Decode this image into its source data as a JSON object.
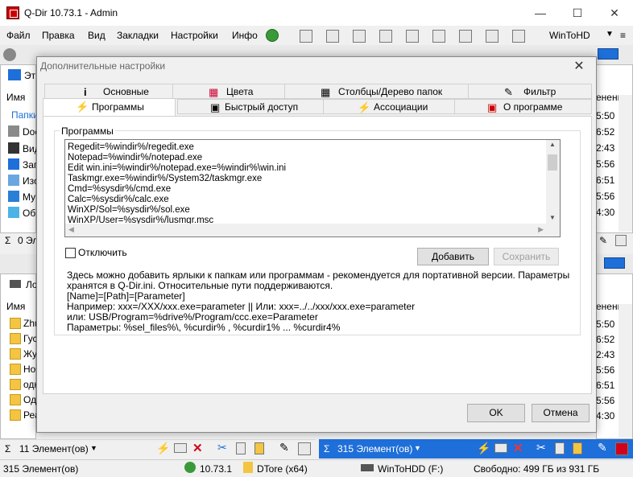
{
  "window": {
    "title": "Q-Dir 10.73.1 - Admin",
    "minimize": "—",
    "maximize": "☐",
    "close": "✕"
  },
  "menu": [
    "Файл",
    "Правка",
    "Вид",
    "Закладки",
    "Настройки",
    "Инфо"
  ],
  "toolbar": {
    "wintohdd_label": "WinToHD"
  },
  "left_pane_top": {
    "address": "Эт",
    "column_name": "Имя",
    "items": [
      "Папки",
      "Doc",
      "Вид",
      "Заг",
      "Изо",
      "Му",
      "Об"
    ],
    "footer_count": "0 Эл"
  },
  "right_pane_top": {
    "column": "енения",
    "times": [
      "5:50",
      "6:52",
      "2:43",
      "5:56",
      "6:51",
      "5:56",
      "4:30"
    ]
  },
  "left_pane_bottom": {
    "address": "Ло",
    "column_name": "Имя",
    "items": [
      "Zhu",
      "Гус",
      "Жу",
      "Но",
      "одн",
      "Оди",
      "Реа"
    ],
    "footer_count": "11 Элемент(ов)"
  },
  "right_pane_bottom": {
    "column": "енения",
    "times": [
      "5:50",
      "6:52",
      "2:43",
      "5:56",
      "6:51",
      "5:56",
      "4:30"
    ],
    "footer_count": "315 Элемент(ов)"
  },
  "dialog": {
    "title": "Дополнительные настройки",
    "close": "✕",
    "tabs_back": [
      "Основные",
      "Цвета",
      "Столбцы/Дерево папок",
      "Фильтр"
    ],
    "tabs_front": [
      "Программы",
      "Быстрый доступ",
      "Ассоциации",
      "О программе"
    ],
    "group_label": "Программы",
    "program_lines": [
      "Regedit=%windir%/regedit.exe",
      "Notepad=%windir%/notepad.exe",
      "Edit win.ini=%windir%/notepad.exe=%windir%\\win.ini",
      "Taskmgr.exe=%windir%/System32/taskmgr.exe",
      "Cmd=%sysdir%/cmd.exe",
      "Calc=%sysdir%/calc.exe",
      "WinXP/Sol=%sysdir%/sol.exe",
      "WinXP/User=%sysdir%/lusmgr.msc"
    ],
    "disable_label": "Отключить",
    "add_button": "Добавить",
    "save_button": "Сохранить",
    "help_lines": [
      "Здесь можно добавить ярлыки к папкам или программам - рекомендуется для портативной версии. Параметры",
      "хранятся в Q-Dir.ini. Относительные пути поддерживаются.",
      "[Name]=[Path]=[Parameter]",
      "Например: xxx=/XXX/xxx.exe=parameter || Или: xxx=../../xxx/xxx.exe=parameter",
      " или: USB/Program=%drive%/Program/ccc.exe=Parameter",
      " Параметры: %sel_files%\\, %curdir% , %curdir1% ... %curdir4%"
    ],
    "ok_button": "OK",
    "cancel_button": "Отмена"
  },
  "status": {
    "count": "315 Элемент(ов)",
    "version": "10.73.1",
    "user": "DTore (x64)",
    "drive": "WinToHDD (F:)",
    "free": "Свободно: 499 ГБ из 931 ГБ"
  },
  "colors": {
    "accent_blue": "#1e6fd9",
    "drive_blue": "#2a7fd6",
    "delete_red": "#d0021b"
  }
}
